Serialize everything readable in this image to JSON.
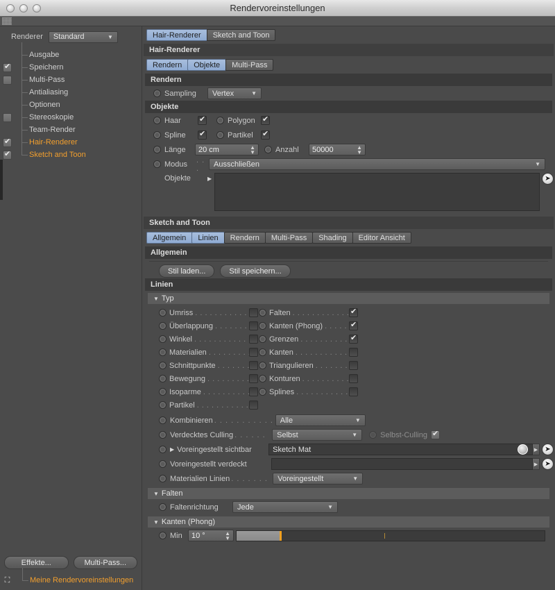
{
  "window": {
    "title": "Rendervoreinstellungen"
  },
  "sidebar": {
    "renderer_label": "Renderer",
    "renderer_value": "Standard",
    "items": [
      {
        "label": "Ausgabe",
        "check": "none",
        "orange": false
      },
      {
        "label": "Speichern",
        "check": "on",
        "orange": false
      },
      {
        "label": "Multi-Pass",
        "check": "off",
        "orange": false
      },
      {
        "label": "Antialiasing",
        "check": "none",
        "orange": false
      },
      {
        "label": "Optionen",
        "check": "none",
        "orange": false
      },
      {
        "label": "Stereoskopie",
        "check": "off",
        "orange": false
      },
      {
        "label": "Team-Render",
        "check": "none",
        "orange": false
      },
      {
        "label": "Hair-Renderer",
        "check": "on",
        "orange": true
      },
      {
        "label": "Sketch and Toon",
        "check": "on",
        "orange": true
      }
    ],
    "effects_button": "Effekte...",
    "multipass_button": "Multi-Pass...",
    "preset_label": "Meine Rendervoreinstellungen",
    "preset_icon": "preset-icon"
  },
  "main": {
    "top_tabs": [
      {
        "label": "Hair-Renderer",
        "active": true
      },
      {
        "label": "Sketch and Toon",
        "active": false
      }
    ],
    "hair": {
      "title": "Hair-Renderer",
      "tabs": [
        {
          "label": "Rendern",
          "active": true
        },
        {
          "label": "Objekte",
          "active": true
        },
        {
          "label": "Multi-Pass",
          "active": false
        }
      ],
      "rendern_header": "Rendern",
      "sampling_label": "Sampling",
      "sampling_value": "Vertex",
      "objekte_header": "Objekte",
      "toggles": [
        {
          "label": "Haar",
          "checked": true
        },
        {
          "label": "Polygon",
          "checked": true
        },
        {
          "label": "Spline",
          "checked": true
        },
        {
          "label": "Partikel",
          "checked": true
        }
      ],
      "laenge_label": "Länge",
      "laenge_value": "20 cm",
      "anzahl_label": "Anzahl",
      "anzahl_value": "50000",
      "modus_label": "Modus",
      "modus_value": "Ausschließen",
      "objekte_label": "Objekte",
      "objekte_list": ""
    },
    "sketch": {
      "title": "Sketch and Toon",
      "tabs": [
        {
          "label": "Allgemein",
          "active": true
        },
        {
          "label": "Linien",
          "active": true
        },
        {
          "label": "Rendern",
          "active": false
        },
        {
          "label": "Multi-Pass",
          "active": false
        },
        {
          "label": "Shading",
          "active": false
        },
        {
          "label": "Editor Ansicht",
          "active": false
        }
      ],
      "allgemein_header": "Allgemein",
      "style_load_button": "Stil laden...",
      "style_save_button": "Stil speichern...",
      "linien_header": "Linien",
      "typ_header": "Typ",
      "typ_left": [
        {
          "label": "Umriss",
          "checked": false
        },
        {
          "label": "Überlappung",
          "checked": false
        },
        {
          "label": "Winkel",
          "checked": false
        },
        {
          "label": "Materialien",
          "checked": false
        },
        {
          "label": "Schnittpunkte",
          "checked": false
        },
        {
          "label": "Bewegung",
          "checked": false
        },
        {
          "label": "Isoparme",
          "checked": false
        },
        {
          "label": "Partikel",
          "checked": false
        }
      ],
      "typ_right": [
        {
          "label": "Falten",
          "checked": true
        },
        {
          "label": "Kanten (Phong)",
          "checked": true
        },
        {
          "label": "Grenzen",
          "checked": true
        },
        {
          "label": "Kanten",
          "checked": false
        },
        {
          "label": "Triangulieren",
          "checked": false
        },
        {
          "label": "Konturen",
          "checked": false
        },
        {
          "label": "Splines",
          "checked": false
        }
      ],
      "kombinieren_label": "Kombinieren",
      "kombinieren_value": "Alle",
      "culling_label": "Verdecktes Culling",
      "culling_value": "Selbst",
      "self_culling_label": "Selbst-Culling",
      "self_culling_checked": true,
      "preset_visible_label": "Voreingestellt sichtbar",
      "preset_visible_value": "Sketch Mat",
      "preset_hidden_label": "Voreingestellt verdeckt",
      "preset_hidden_value": "",
      "material_lines_label": "Materialien Linien",
      "material_lines_value": "Voreingestellt",
      "falten_header": "Falten",
      "faltenrichtung_label": "Faltenrichtung",
      "faltenrichtung_value": "Jede",
      "kanten_phong_header": "Kanten (Phong)",
      "min_label": "Min",
      "min_value": "10 °",
      "min_fill_percent": 14,
      "min_tick_percent": 48
    }
  },
  "colors": {
    "accent_orange": "#f29f2e",
    "tab_active_blue": "#8fabd3",
    "panel_bg": "#4a4a4a",
    "header_bg": "#3f3f3f",
    "slider_knob": "#f0a020"
  }
}
